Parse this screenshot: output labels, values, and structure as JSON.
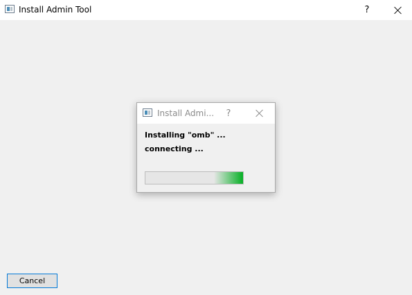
{
  "window": {
    "title": "Install Admin Tool",
    "help_label": "?"
  },
  "dialog": {
    "title": "Install Admi...",
    "help_label": "?",
    "status_line1": "Installing \"omb\" ...",
    "status_line2": "connecting ...",
    "progress_style": "indeterminate",
    "progress_color": "#06b025"
  },
  "footer": {
    "cancel_label": "Cancel"
  }
}
